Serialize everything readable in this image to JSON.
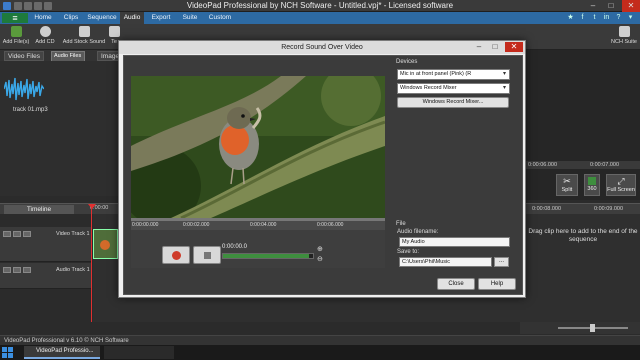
{
  "window": {
    "title": "VideoPad Professional by NCH Software - Untitled.vpj* - Licensed software",
    "controls": {
      "minimize": "–",
      "maximize": "□",
      "close": "✕"
    }
  },
  "menu": {
    "hamburger": "≡",
    "tabs": [
      "Home",
      "Clips",
      "Sequence",
      "Audio",
      "Export",
      "Suite",
      "Custom"
    ],
    "active_tab": "Audio"
  },
  "toolbar": {
    "add_files": "Add File(s)",
    "add_cd": "Add CD",
    "add_stock_sound": "Add Stock Sound",
    "text_cut": "Te",
    "nch_suite": "NCH Suite"
  },
  "bin": {
    "tabs": [
      "Video Files",
      "Audio Files",
      "Image"
    ],
    "clip_name": "track 01.mp3"
  },
  "preview_right": {
    "ruler": [
      "0:00:06.000",
      "0:00:07.000"
    ],
    "split": "Split",
    "b360": "360",
    "full_screen": "Full Screen"
  },
  "timeline": {
    "label": "Timeline",
    "ruler_time": "0:00:00",
    "right_ruler": [
      "0:00:08.000",
      "0:00:09.000"
    ],
    "video_track": "Video Track 1",
    "audio_track": "Audio Track 1",
    "hint": "Drag clip here to add to the end of the sequence"
  },
  "status": {
    "text": "VideoPad Professional v 6.10 © NCH Software"
  },
  "taskbar": {
    "item": "VideoPad Professio..."
  },
  "dialog": {
    "title": "Record Sound Over Video",
    "ruler": [
      "0:00:00.000",
      "0:00:02.000",
      "0:00:04.000",
      "0:00:06.000"
    ],
    "time_readout": "0:00:00.0",
    "volume_level": 0.96,
    "devices_label": "Devices",
    "device_input": "Mic in at front panel (Pink) (R",
    "device_mixer": "Windows Record Mixer",
    "mixer_button": "Windows Record Mixer...",
    "file_label": "File",
    "audio_filename_label": "Audio filename:",
    "audio_filename": "My Audio",
    "save_to_label": "Save to:",
    "save_to": "C:\\Users\\Phil\\Music",
    "browse": "...",
    "close_button": "Close",
    "help_button": "Help"
  }
}
